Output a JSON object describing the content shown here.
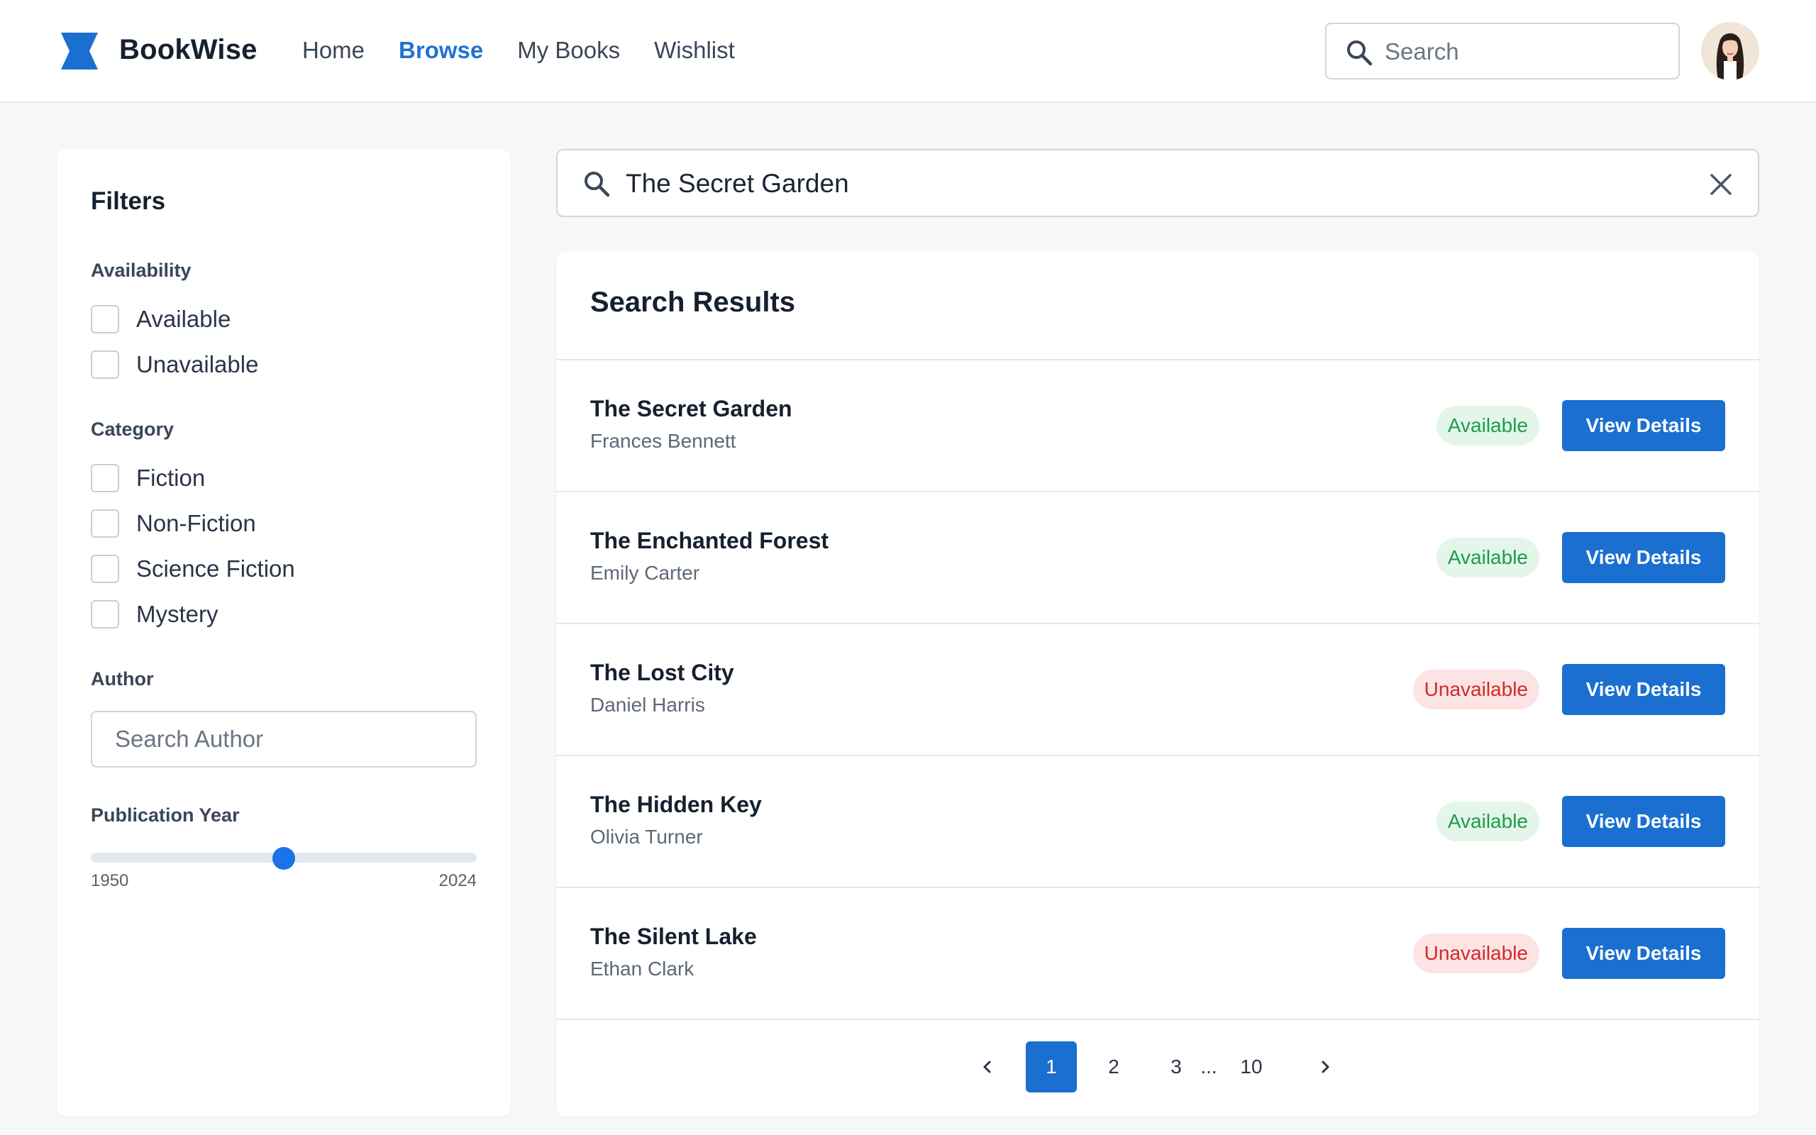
{
  "brand": {
    "name": "BookWise",
    "color": "#1a6fd0"
  },
  "nav": {
    "items": [
      {
        "label": "Home",
        "active": false
      },
      {
        "label": "Browse",
        "active": true
      },
      {
        "label": "My Books",
        "active": false
      },
      {
        "label": "Wishlist",
        "active": false
      }
    ]
  },
  "header_search": {
    "placeholder": "Search",
    "icon": "search-icon"
  },
  "user": {
    "avatar_icon": "user-avatar"
  },
  "filters": {
    "title": "Filters",
    "availability": {
      "label": "Availability",
      "options": [
        "Available",
        "Unavailable"
      ]
    },
    "category": {
      "label": "Category",
      "options": [
        "Fiction",
        "Non-Fiction",
        "Science Fiction",
        "Mystery"
      ]
    },
    "author": {
      "label": "Author",
      "placeholder": "Search Author"
    },
    "publication_year": {
      "label": "Publication Year",
      "min": "1950",
      "max": "2024",
      "level": 0.5
    }
  },
  "main_search": {
    "value": "The Secret Garden",
    "icon": "search-icon",
    "clear_icon": "close-icon"
  },
  "results": {
    "title": "Search Results",
    "action_label": "View Details",
    "items": [
      {
        "title": "The Secret Garden",
        "author": "Frances Bennett",
        "status": "Available"
      },
      {
        "title": "The Enchanted Forest",
        "author": "Emily Carter",
        "status": "Available"
      },
      {
        "title": "The Lost City",
        "author": "Daniel Harris",
        "status": "Unavailable"
      },
      {
        "title": "The Hidden Key",
        "author": "Olivia Turner",
        "status": "Available"
      },
      {
        "title": "The Silent Lake",
        "author": "Ethan Clark",
        "status": "Unavailable"
      }
    ]
  },
  "pagination": {
    "prev_icon": "chevron-left-icon",
    "next_icon": "chevron-right-icon",
    "pages": [
      "1",
      "2",
      "3"
    ],
    "ellipsis": "...",
    "last": "10",
    "current": "1"
  },
  "colors": {
    "accent": "#1a6fd0",
    "available_bg": "#e3f6e9",
    "available_text": "#1f9a4c",
    "unavailable_bg": "#fce4e4",
    "unavailable_text": "#d22a2a"
  }
}
